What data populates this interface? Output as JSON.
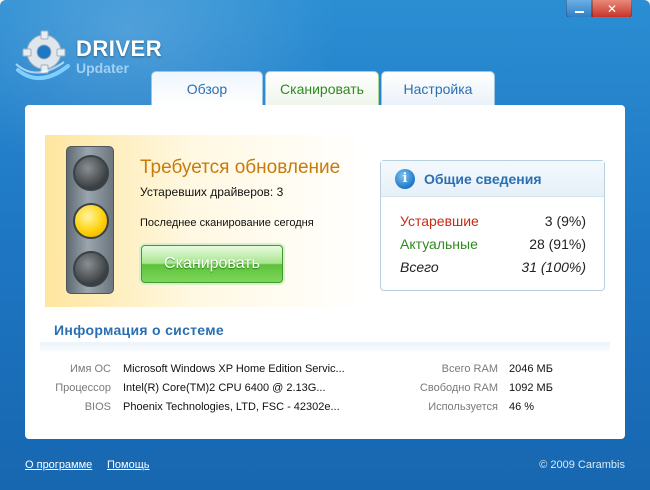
{
  "window": {
    "minimize_label": "_",
    "close_label": "✕"
  },
  "logo": {
    "title": "DRIVER",
    "subtitle": "Updater"
  },
  "tabs": [
    {
      "label": "Обзор"
    },
    {
      "label": "Сканировать"
    },
    {
      "label": "Настройка"
    }
  ],
  "status": {
    "title": "Требуется обновление",
    "outdated_line": "Устаревших драйверов: 3",
    "last_scan_line": "Последнее сканирование  сегодня",
    "scan_button": "Сканировать",
    "light_active": "yellow"
  },
  "summary": {
    "title": "Общие сведения",
    "rows": [
      {
        "label": "Устаревшие",
        "value": "3 (9%)"
      },
      {
        "label": "Актуальные",
        "value": "28 (91%)"
      },
      {
        "label": "Всего",
        "value": "31 (100%)"
      }
    ]
  },
  "system": {
    "title": "Информация о системе",
    "left": [
      {
        "label": "Имя ОС",
        "value": "Microsoft Windows XP Home Edition Servic..."
      },
      {
        "label": "Процессор",
        "value": "Intel(R) Core(TM)2 CPU         6400  @ 2.13G..."
      },
      {
        "label": "BIOS",
        "value": "Phoenix Technologies, LTD, FSC    - 42302e..."
      }
    ],
    "right": [
      {
        "label": "Всего RAM",
        "value": "2046 МБ"
      },
      {
        "label": "Свободно RAM",
        "value": "1092 МБ"
      },
      {
        "label": "Используется",
        "value": "46 %"
      }
    ]
  },
  "footer": {
    "about": "О программе",
    "help": "Помощь",
    "copyright": "© 2009 Carambis"
  },
  "colors": {
    "background": "#1f78c4",
    "accent": "#2a6fb3",
    "warning": "#c97a0a",
    "outdated": "#c72a14",
    "current": "#2f8a20"
  }
}
